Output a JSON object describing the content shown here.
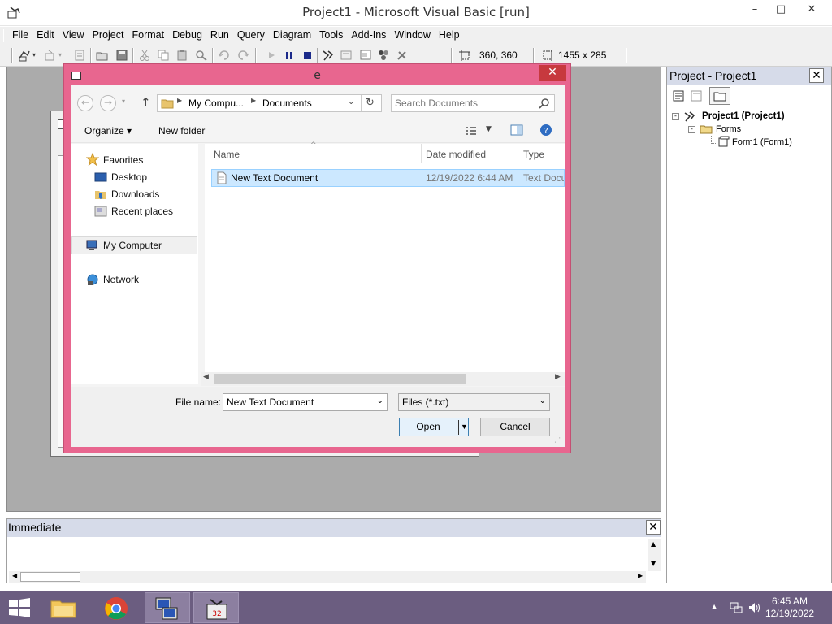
{
  "window": {
    "title": "Project1 - Microsoft Visual Basic [run]",
    "minimize": "–",
    "maximize": "□",
    "close": "✕"
  },
  "menu": [
    "File",
    "Edit",
    "View",
    "Project",
    "Format",
    "Debug",
    "Run",
    "Query",
    "Diagram",
    "Tools",
    "Add-Ins",
    "Window",
    "Help"
  ],
  "toolbar": {
    "position": "360, 360",
    "size": "1455 x 285"
  },
  "dialog": {
    "title": "e",
    "close": "✕",
    "back": "←",
    "forward": "→",
    "up": "↑",
    "breadcrumb": [
      "My Compu...",
      "Documents"
    ],
    "search_placeholder": "Search Documents",
    "organize": "Organize ▾",
    "new_folder": "New folder",
    "nav": {
      "favorites": "Favorites",
      "desktop": "Desktop",
      "downloads": "Downloads",
      "recent": "Recent places",
      "my_computer": "My Computer",
      "network": "Network"
    },
    "columns": {
      "name": "Name",
      "date": "Date modified",
      "type": "Type"
    },
    "files": [
      {
        "name": "New Text Document",
        "date": "12/19/2022 6:44 AM",
        "type": "Text Docu"
      }
    ],
    "file_name_label": "File name:",
    "file_name_value": "New Text Document",
    "file_type": "Files (*.txt)",
    "open": "Open",
    "cancel": "Cancel"
  },
  "project_panel": {
    "title": "Project - Project1",
    "close": "✕",
    "tree": {
      "root": "Project1 (Project1)",
      "folder": "Forms",
      "item": "Form1 (Form1)"
    }
  },
  "immediate": {
    "title": "Immediate",
    "close": "✕"
  },
  "taskbar": {
    "time": "6:45 AM",
    "date": "12/19/2022",
    "tray_arrow": "▲"
  },
  "colors": {
    "dialog_frame": "#e8668f",
    "taskbar": "#6b5d80",
    "selection": "#cce8ff",
    "close_red": "#c7393e"
  }
}
